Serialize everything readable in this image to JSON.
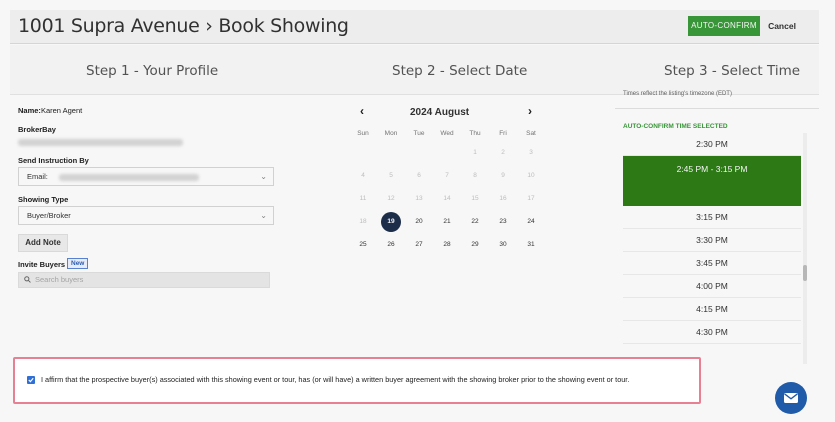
{
  "header": {
    "title": "1001 Supra Avenue › Book Showing",
    "auto_confirm_label": "AUTO-CONFIRM",
    "cancel_label": "Cancel"
  },
  "steps": {
    "step1": "Step 1 - Your Profile",
    "step2": "Step 2 - Select Date",
    "step3": "Step 3 - Select Time"
  },
  "profile": {
    "name_label": "Name:",
    "name_value": "Karen Agent",
    "brokerbay_label": "BrokerBay",
    "send_instruction_label": "Send Instruction By",
    "send_instruction_value": "Email:",
    "showing_type_label": "Showing Type",
    "showing_type_value": "Buyer/Broker",
    "add_note_label": "Add Note",
    "invite_buyers_label": "Invite Buyers",
    "new_badge": "New",
    "search_placeholder": "Search buyers"
  },
  "calendar": {
    "month_title": "2024 August",
    "prev_icon": "chevron-left-icon",
    "next_icon": "chevron-right-icon",
    "weekdays": [
      "Sun",
      "Mon",
      "Tue",
      "Wed",
      "Thu",
      "Fri",
      "Sat"
    ],
    "selected_day": "19",
    "rows": [
      [
        {
          "d": "",
          "s": "empty"
        },
        {
          "d": "",
          "s": "empty"
        },
        {
          "d": "",
          "s": "empty"
        },
        {
          "d": "",
          "s": "empty"
        },
        {
          "d": "1",
          "s": "muted"
        },
        {
          "d": "2",
          "s": "muted"
        },
        {
          "d": "3",
          "s": "muted"
        }
      ],
      [
        {
          "d": "4",
          "s": "muted"
        },
        {
          "d": "5",
          "s": "muted"
        },
        {
          "d": "6",
          "s": "muted"
        },
        {
          "d": "7",
          "s": "muted"
        },
        {
          "d": "8",
          "s": "muted"
        },
        {
          "d": "9",
          "s": "muted"
        },
        {
          "d": "10",
          "s": "muted"
        }
      ],
      [
        {
          "d": "11",
          "s": "muted"
        },
        {
          "d": "12",
          "s": "muted"
        },
        {
          "d": "13",
          "s": "muted"
        },
        {
          "d": "14",
          "s": "muted"
        },
        {
          "d": "15",
          "s": "muted"
        },
        {
          "d": "16",
          "s": "muted"
        },
        {
          "d": "17",
          "s": "muted"
        }
      ],
      [
        {
          "d": "18",
          "s": "muted"
        },
        {
          "d": "19",
          "s": "selected"
        },
        {
          "d": "20",
          "s": "active"
        },
        {
          "d": "21",
          "s": "active"
        },
        {
          "d": "22",
          "s": "active"
        },
        {
          "d": "23",
          "s": "active"
        },
        {
          "d": "24",
          "s": "active"
        }
      ],
      [
        {
          "d": "25",
          "s": "active"
        },
        {
          "d": "26",
          "s": "active"
        },
        {
          "d": "27",
          "s": "active"
        },
        {
          "d": "28",
          "s": "active"
        },
        {
          "d": "29",
          "s": "active"
        },
        {
          "d": "30",
          "s": "active"
        },
        {
          "d": "31",
          "s": "active"
        }
      ]
    ]
  },
  "time": {
    "timezone_note": "Times reflect the listing's timezone (EDT)",
    "auto_confirm_selected_label": "AUTO-CONFIRM TIME SELECTED",
    "slots": [
      "2:30 PM",
      "2:45 PM - 3:15 PM",
      "3:15 PM",
      "3:30 PM",
      "3:45 PM",
      "4:00 PM",
      "4:15 PM",
      "4:30 PM"
    ],
    "selected_index": 1
  },
  "affirm": {
    "checked": true,
    "text": "I affirm that the prospective buyer(s) associated with this showing event or tour, has (or will have) a written buyer agreement with the showing broker prior to the showing event or tour."
  },
  "colors": {
    "accent_green": "#3a9a3a",
    "selected_slot": "#2e7d16",
    "selected_day": "#1d2f4d",
    "highlight_border": "#e88094",
    "chat_button": "#1f5ba8"
  },
  "icons": {
    "search": "search-icon",
    "dropdown": "chevron-down-icon",
    "checkbox": "checkbox-checked-icon",
    "chat": "mail-icon"
  }
}
